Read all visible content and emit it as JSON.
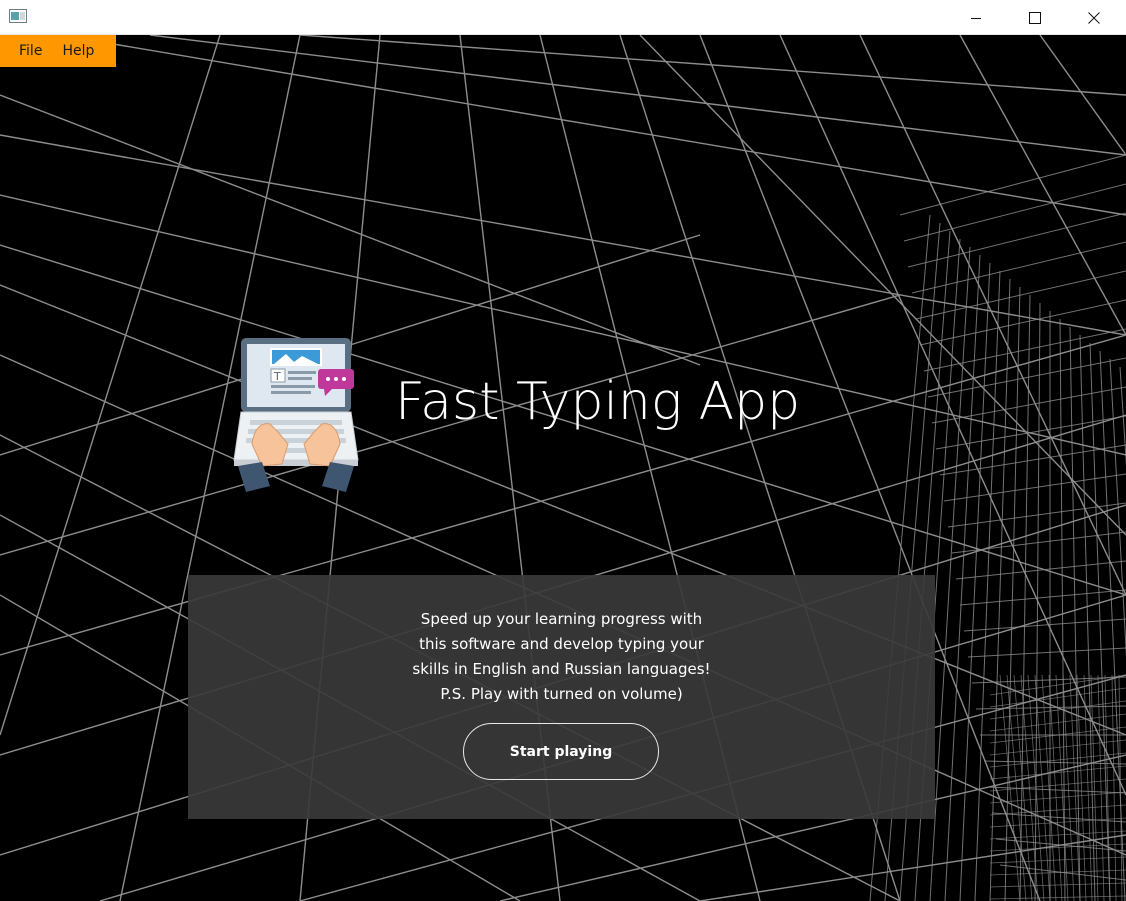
{
  "window": {
    "minimize_glyph": "minimize-icon",
    "maximize_glyph": "maximize-icon",
    "close_glyph": "close-icon"
  },
  "menu": {
    "items": [
      {
        "label": "File"
      },
      {
        "label": "Help"
      }
    ]
  },
  "hero": {
    "title": "Fast Typing App",
    "logo_icon": "laptop-typing-icon"
  },
  "panel": {
    "description_lines": [
      "Speed up your learning progress with",
      "this software and develop typing your",
      "skills in English and Russian languages!",
      "P.S. Play with turned on volume)"
    ],
    "start_button_label": "Start playing"
  },
  "colors": {
    "menu_bar": "#ff9800",
    "background": "#000000",
    "panel": "#3a3a3a",
    "text": "#ffffff"
  }
}
